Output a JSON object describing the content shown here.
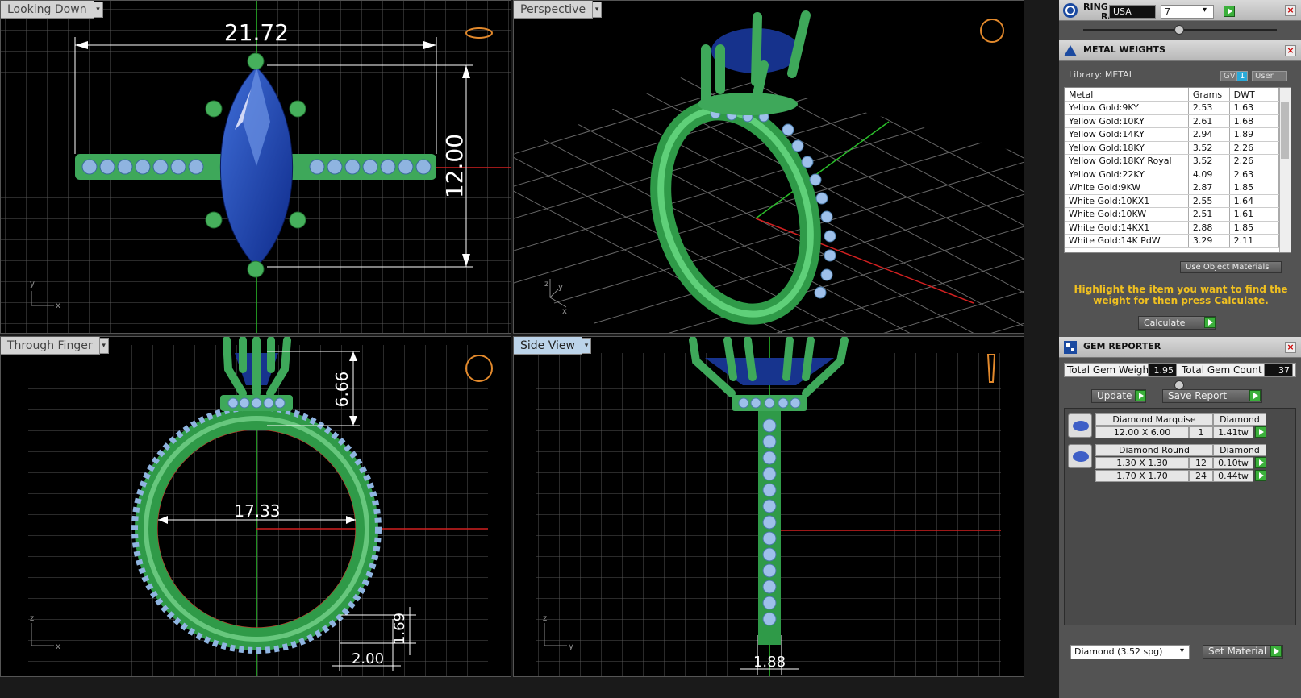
{
  "viewports": {
    "top": {
      "title": "Looking Down",
      "dim_width": "21.72",
      "dim_height": "12.00",
      "axis_x": "x",
      "axis_y": "y"
    },
    "perspective": {
      "title": "Perspective",
      "axis_x": "x",
      "axis_y": "y",
      "axis_z": "z"
    },
    "front": {
      "title": "Through Finger",
      "dim_top": "6.66",
      "dim_diameter": "17.33",
      "dim_thick": "1.69",
      "dim_width": "2.00",
      "axis_x": "x",
      "axis_z": "z"
    },
    "side": {
      "title": "Side View",
      "dim_width": "1.88",
      "axis_y": "y",
      "axis_z": "z"
    }
  },
  "ring_rail": {
    "title_line1": "RING",
    "title_line2": "RAIL",
    "country": "USA",
    "size": "7"
  },
  "metal_weights": {
    "title": "METAL WEIGHTS",
    "library": "Library: METAL",
    "gv_label": "GV",
    "gv_value": "1",
    "user_label": "User",
    "columns": [
      "Metal",
      "Grams",
      "DWT"
    ],
    "rows": [
      [
        "Yellow Gold:9KY",
        "2.53",
        "1.63"
      ],
      [
        "Yellow Gold:10KY",
        "2.61",
        "1.68"
      ],
      [
        "Yellow Gold:14KY",
        "2.94",
        "1.89"
      ],
      [
        "Yellow Gold:18KY",
        "3.52",
        "2.26"
      ],
      [
        "Yellow Gold:18KY Royal",
        "3.52",
        "2.26"
      ],
      [
        "Yellow Gold:22KY",
        "4.09",
        "2.63"
      ],
      [
        "White Gold:9KW",
        "2.87",
        "1.85"
      ],
      [
        "White Gold:10KX1",
        "2.55",
        "1.64"
      ],
      [
        "White Gold:10KW",
        "2.51",
        "1.61"
      ],
      [
        "White Gold:14KX1",
        "2.88",
        "1.85"
      ],
      [
        "White Gold:14K PdW",
        "3.29",
        "2.11"
      ]
    ],
    "use_object_materials": "Use Object Materials",
    "hint": "Highlight the item you want to find the weight for then press Calculate.",
    "calculate": "Calculate"
  },
  "gem_reporter": {
    "title": "GEM REPORTER",
    "total_weight_label": "Total Gem Weight",
    "total_weight": "1.95",
    "total_count_label": "Total Gem Count",
    "total_count": "37",
    "update": "Update",
    "save_report": "Save Report",
    "gems": [
      {
        "name": "Diamond Marquise",
        "material": "Diamond",
        "rows": [
          [
            "12.00 X 6.00",
            "1",
            "1.41tw"
          ]
        ]
      },
      {
        "name": "Diamond Round",
        "material": "Diamond",
        "rows": [
          [
            "1.30 X 1.30",
            "12",
            "0.10tw"
          ],
          [
            "1.70 X 1.70",
            "24",
            "0.44tw"
          ]
        ]
      }
    ],
    "material_select": "Diamond    (3.52 spg)",
    "set_material": "Set Material"
  }
}
